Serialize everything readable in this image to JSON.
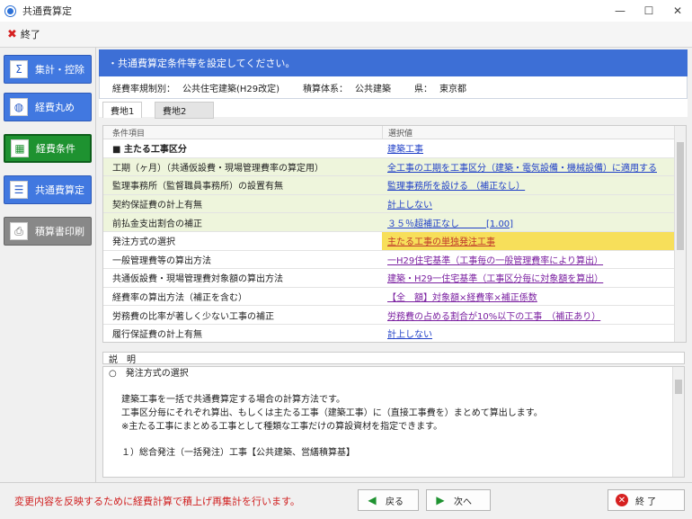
{
  "window": {
    "title": "共通費算定",
    "minimize": "—",
    "maximize": "☐",
    "close": "✕"
  },
  "toolbar": {
    "exit_label": "終了"
  },
  "sidebar": {
    "items": [
      {
        "label": "集計・控除",
        "icon": "sigma-icon"
      },
      {
        "label": "経費丸め",
        "icon": "round-icon"
      },
      {
        "label": "経費条件",
        "icon": "table-icon"
      },
      {
        "label": "共通費算定",
        "icon": "list-icon"
      },
      {
        "label": "積算書印刷",
        "icon": "printer-icon"
      }
    ]
  },
  "main": {
    "header": "・共通費算定条件等を設定してください。",
    "info": {
      "label1": "経費率規制別：",
      "value1": "公共住宅建築(H29改定)",
      "label2": "積算体系：",
      "value2": "公共建築",
      "label3": "県：",
      "value3": "東京都"
    },
    "tabs": [
      {
        "label": "費地1"
      },
      {
        "label": "費地2"
      }
    ],
    "grid": {
      "col1": "条件項目",
      "col2": "選択値",
      "rows": [
        {
          "item": "■ 主たる工事区分",
          "value": "建築工事"
        },
        {
          "item": "工期（ヶ月）（共通仮設費・現場管理費率の算定用）",
          "value": "全工事の工期を工事区分（建築・電気設備・機械設備）に適用する"
        },
        {
          "item": "監理事務所（監督職員事務所）の設置有無",
          "value": "監理事務所を設ける （補正なし）"
        },
        {
          "item": "契約保証費の計上有無",
          "value": "計上しない"
        },
        {
          "item": "前払金支出割合の補正",
          "value": "３５％超補正なし　　　[1.00]"
        },
        {
          "item": "発注方式の選択",
          "value": "主たる工事の単独発注工事"
        },
        {
          "item": "一般管理費等の算出方法",
          "value": "一H29住宅基準（工事毎の一般管理費率により算出）"
        },
        {
          "item": "共通仮設費・現場管理費対象額の算出方法",
          "value": "建築・H29一住宅基準（工事区分毎に対象額を算出）"
        },
        {
          "item": "経費率の算出方法（補正を含む）",
          "value": "【全　額】対象額×経費率×補正係数"
        },
        {
          "item": "労務費の比率が著しく少ない工事の補正",
          "value": "労務費の占める割合が10%以下の工事　（補正あり）"
        },
        {
          "item": "履行保証費の計上有無",
          "value": "計上しない"
        }
      ]
    },
    "desc": {
      "label": "説　明",
      "title": "○　発注方式の選択",
      "lines": [
        "建築工事を一括で共通費算定する場合の計算方法です。",
        "工事区分毎にそれぞれ算出、もしくは主たる工事（建築工事）に（直接工事費を）まとめて算出します。",
        "※主たる工事にまとめる工事として種類な工事だけの算設資材を指定できます。",
        "１）総合発注（一括発注）工事【公共建築、営繕積算基】"
      ]
    }
  },
  "footer": {
    "message": "変更内容を反映するために経費計算で積上げ再集計を行います。",
    "back": "戻る",
    "next": "次へ",
    "exit": "終 了"
  }
}
